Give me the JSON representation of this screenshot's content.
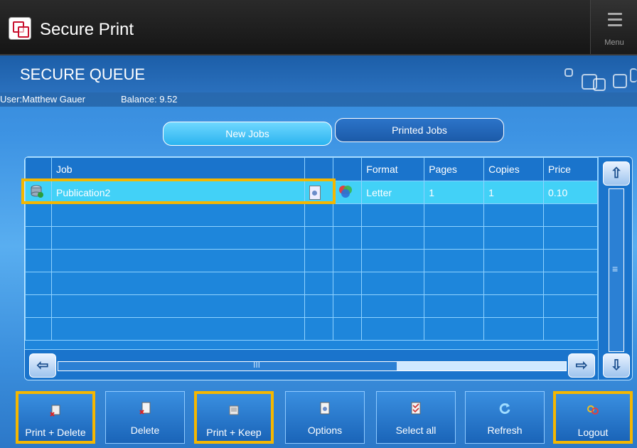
{
  "app": {
    "title": "Secure Print",
    "menu_label": "Menu"
  },
  "queue": {
    "title": "SECURE QUEUE"
  },
  "user": {
    "label": "User:Matthew Gauer",
    "balance": "Balance: 9.52"
  },
  "tabs": [
    {
      "label": "New Jobs",
      "active": true
    },
    {
      "label": "Printed Jobs",
      "active": false
    }
  ],
  "table": {
    "columns": [
      "Job",
      "",
      "",
      "Format",
      "Pages",
      "Copies",
      "Price"
    ],
    "rows": [
      {
        "job": "Publication2",
        "format": "Letter",
        "pages": "1",
        "copies": "1",
        "price": "0.10",
        "selected": true
      }
    ]
  },
  "buttons": [
    {
      "label": "Print + Delete",
      "icon": "print-delete-icon"
    },
    {
      "label": "Delete",
      "icon": "delete-icon"
    },
    {
      "label": "Print + Keep",
      "icon": "print-keep-icon"
    },
    {
      "label": "Options",
      "icon": "options-icon"
    },
    {
      "label": "Select all",
      "icon": "select-all-icon"
    },
    {
      "label": "Refresh",
      "icon": "refresh-icon"
    },
    {
      "label": "Logout",
      "icon": "logout-icon"
    }
  ],
  "colors": {
    "highlight": "#f5b700",
    "selected_row": "#42d1f7",
    "title_bar": "#1a1a1a"
  }
}
